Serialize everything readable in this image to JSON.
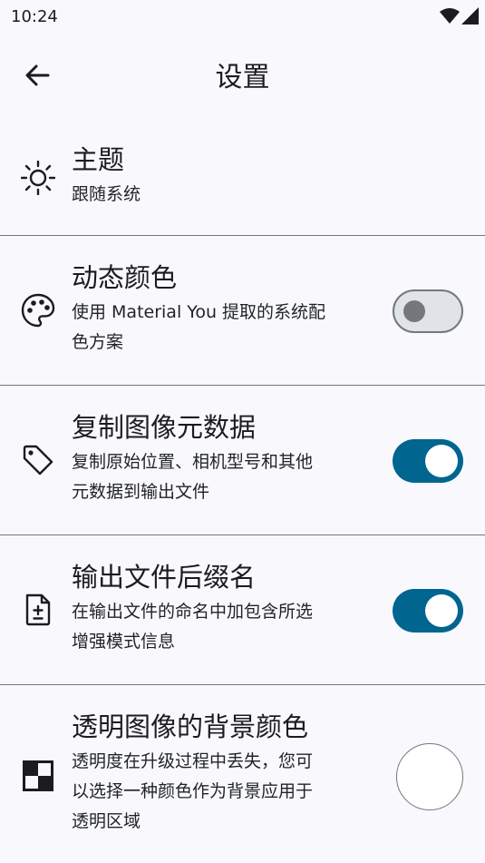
{
  "status_bar": {
    "time": "10:24"
  },
  "top_bar": {
    "title": "设置"
  },
  "settings": [
    {
      "title": "主题",
      "description": "跟随系统",
      "icon": "sun-icon"
    },
    {
      "title": "动态颜色",
      "description_lines": [
        "使用 Material You 提取的系统配",
        "色方案"
      ],
      "icon": "palette-icon",
      "toggle": false
    },
    {
      "title": "复制图像元数据",
      "description_lines": [
        "复制原始位置、相机型号和其他",
        "元数据到输出文件"
      ],
      "icon": "tag-icon",
      "toggle": true
    },
    {
      "title": "输出文件后缀名",
      "description_lines": [
        "在输出文件的命名中加包含所选",
        "增强模式信息"
      ],
      "icon": "file-plus-minus-icon",
      "toggle": true
    },
    {
      "title": "透明图像的背景颜色",
      "description_lines": [
        "透明度在升级过程中丢失，您可",
        "以选择一种颜色作为背景应用于",
        "透明区域"
      ],
      "icon": "transparency-checker-icon",
      "color": "#ffffff"
    }
  ],
  "colors": {
    "accent": "#00658f",
    "background": "#f9f9fd",
    "toggle_off": "#e0e3e8"
  }
}
